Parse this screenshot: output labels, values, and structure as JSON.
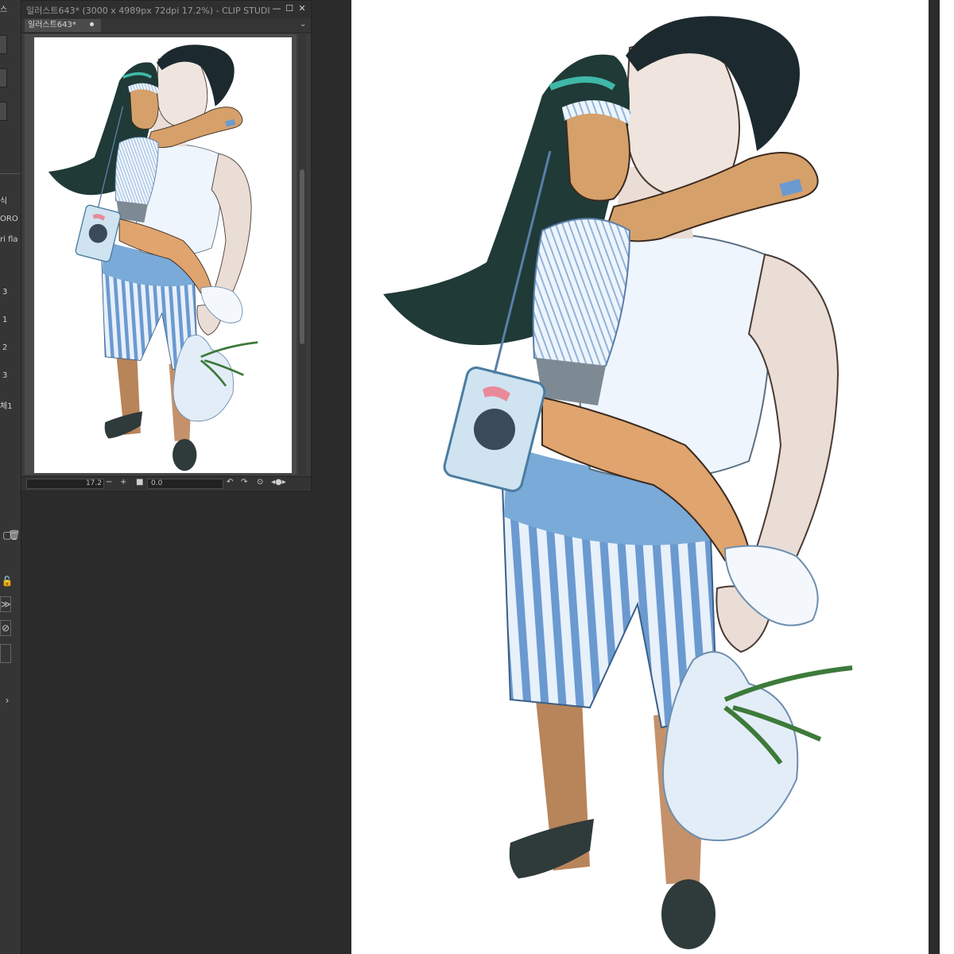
{
  "window": {
    "title": "일러스트643* (3000 x 4989px 72dpi 17.2%)  - CLIP STUDI",
    "tab_label": "일러스트643*"
  },
  "navigator": {
    "zoom_value": "17.2",
    "angle_value": "0.0"
  },
  "left_panel": {
    "labels": [
      "스",
      "식",
      "ORO",
      "ri fla"
    ],
    "numbers": [
      "3",
      "1",
      "2",
      "3",
      "체1"
    ]
  },
  "colors": {
    "app_bg": "#2b2b2b",
    "panel_bg": "#3c3c3c",
    "paper": "#ffffff",
    "hair": "#1f3a37",
    "stripe_blue": "#6a9ad0",
    "skin_man": "#e9ddd6",
    "skin_girl": "#d6a06a"
  }
}
